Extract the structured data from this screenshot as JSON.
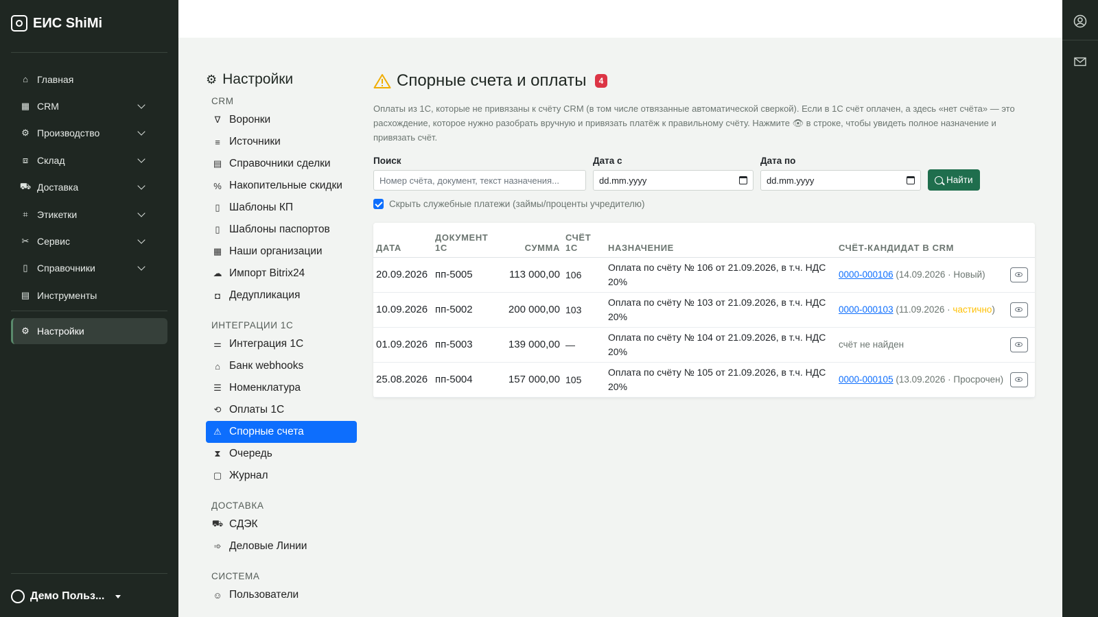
{
  "app": {
    "brand": "ЕИС ShiMi"
  },
  "sidebar": {
    "items": [
      {
        "label": "Главная",
        "icon": "home-icon",
        "glyph": "⌂",
        "has_chevron": false
      },
      {
        "label": "CRM",
        "icon": "crm-icon",
        "glyph": "▦",
        "has_chevron": true
      },
      {
        "label": "Производство",
        "icon": "production-gear-icon",
        "glyph": "⚙",
        "has_chevron": true
      },
      {
        "label": "Склад",
        "icon": "box-icon",
        "glyph": "⧈",
        "has_chevron": true
      },
      {
        "label": "Доставка",
        "icon": "truck-icon",
        "glyph": "⛟",
        "has_chevron": true
      },
      {
        "label": "Этикетки",
        "icon": "tag-icon",
        "glyph": "⌗",
        "has_chevron": true
      },
      {
        "label": "Сервис",
        "icon": "tools-icon",
        "glyph": "✂",
        "has_chevron": true
      },
      {
        "label": "Справочники",
        "icon": "book-icon",
        "glyph": "▯",
        "has_chevron": true
      },
      {
        "label": "Инструменты",
        "icon": "calculator-icon",
        "glyph": "▤",
        "has_chevron": false
      }
    ],
    "active": {
      "label": "Настройки",
      "icon": "settings-gear-icon",
      "glyph": "⚙"
    },
    "user": {
      "name": "Демо Польз..."
    }
  },
  "settings": {
    "title": "Настройки",
    "sections": [
      {
        "heading": "CRM",
        "items": [
          {
            "label": "Воронки",
            "icon": "funnel-icon",
            "glyph": "∇"
          },
          {
            "label": "Источники",
            "icon": "sources-icon",
            "glyph": "≡"
          },
          {
            "label": "Справочники сделки",
            "icon": "deal-directory-icon",
            "glyph": "▤"
          },
          {
            "label": "Накопительные скидки",
            "icon": "percent-icon",
            "glyph": "%"
          },
          {
            "label": "Шаблоны КП",
            "icon": "document-icon",
            "glyph": "▯"
          },
          {
            "label": "Шаблоны паспортов",
            "icon": "passport-template-icon",
            "glyph": "▯"
          },
          {
            "label": "Наши организации",
            "icon": "building-icon",
            "glyph": "▦"
          },
          {
            "label": "Импорт Bitrix24",
            "icon": "cloud-import-icon",
            "glyph": "☁"
          },
          {
            "label": "Дедупликация",
            "icon": "duplicate-icon",
            "glyph": "◘"
          }
        ]
      },
      {
        "heading": "ИНТЕГРАЦИИ 1С",
        "items": [
          {
            "label": "Интеграция 1С",
            "icon": "sliders-icon",
            "glyph": "⚌"
          },
          {
            "label": "Банк webhooks",
            "icon": "bank-icon",
            "glyph": "⌂"
          },
          {
            "label": "Номенклатура",
            "icon": "list-icon",
            "glyph": "☰"
          },
          {
            "label": "Оплаты 1С",
            "icon": "payments-icon",
            "glyph": "⟲"
          },
          {
            "label": "Спорные счета",
            "icon": "warning-icon",
            "glyph": "⚠",
            "active": true
          },
          {
            "label": "Очередь",
            "icon": "hourglass-icon",
            "glyph": "⧗"
          },
          {
            "label": "Журнал",
            "icon": "journal-icon",
            "glyph": "▢"
          }
        ]
      },
      {
        "heading": "ДОСТАВКА",
        "items": [
          {
            "label": "СДЭК",
            "icon": "truck-icon",
            "glyph": "⛟"
          },
          {
            "label": "Деловые Линии",
            "icon": "delivery-truck-icon",
            "glyph": "➾"
          }
        ]
      },
      {
        "heading": "СИСТЕМА",
        "items": [
          {
            "label": "Пользователи",
            "icon": "users-icon",
            "glyph": "☺"
          }
        ]
      }
    ]
  },
  "main": {
    "title": "Спорные счета и оплаты",
    "badge": "4",
    "description": "Оплаты из 1С, которые не привязаны к счёту CRM (в том числе отвязанные автоматической сверкой). Если в 1С счёт оплачен, а здесь «нет счёта» — это расхождение, которое нужно разобрать вручную и привязать платёж к правильному счёту. Нажмите 👁 в строке, чтобы увидеть полное назначение и привязать счёт.",
    "filters": {
      "search_label": "Поиск",
      "search_placeholder": "Номер счёта, документ, текст назначения...",
      "date_from_label": "Дата с",
      "date_from_value": "dd.mm.yyyy",
      "date_to_label": "Дата по",
      "date_to_value": "dd.mm.yyyy",
      "find_button": "Найти",
      "hide_service_label": "Скрыть служебные платежи (займы/проценты учредителю)",
      "hide_service_checked": true
    },
    "table": {
      "headers": {
        "date": "ДАТА",
        "document": "ДОКУМЕНТ 1С",
        "amount": "СУММА",
        "invoice_1c": "СЧЁТ 1С",
        "purpose": "НАЗНАЧЕНИЕ",
        "candidate": "СЧЁТ-КАНДИДАТ В CRM"
      },
      "rows": [
        {
          "date": "20.09.2026",
          "document": "пп-5005",
          "amount": "113 000,00",
          "invoice_1c": "106",
          "purpose": "Оплата по счёту № 106 от 21.09.2026, в т.ч. НДС 20%",
          "candidate_link": "0000-000106",
          "candidate_meta": "(14.09.2026 · Новый)",
          "candidate_status": "",
          "candidate_close": ""
        },
        {
          "date": "10.09.2026",
          "document": "пп-5002",
          "amount": "200 000,00",
          "invoice_1c": "103",
          "purpose": "Оплата по счёту № 103 от 21.09.2026, в т.ч. НДС 20%",
          "candidate_link": "0000-000103",
          "candidate_meta": "(11.09.2026 · ",
          "candidate_status": "частично",
          "candidate_close": ")"
        },
        {
          "date": "01.09.2026",
          "document": "пп-5003",
          "amount": "139 000,00",
          "invoice_1c": "—",
          "purpose": "Оплата по счёту № 104 от 21.09.2026, в т.ч. НДС 20%",
          "candidate_link": "",
          "candidate_meta": "счёт не найден",
          "candidate_status": "",
          "candidate_close": ""
        },
        {
          "date": "25.08.2026",
          "document": "пп-5004",
          "amount": "157 000,00",
          "invoice_1c": "105",
          "purpose": "Оплата по счёту № 105 от 21.09.2026, в т.ч. НДС 20%",
          "candidate_link": "0000-000105",
          "candidate_meta": "(13.09.2026 · Просрочен)",
          "candidate_status": "",
          "candidate_close": ""
        }
      ]
    }
  }
}
